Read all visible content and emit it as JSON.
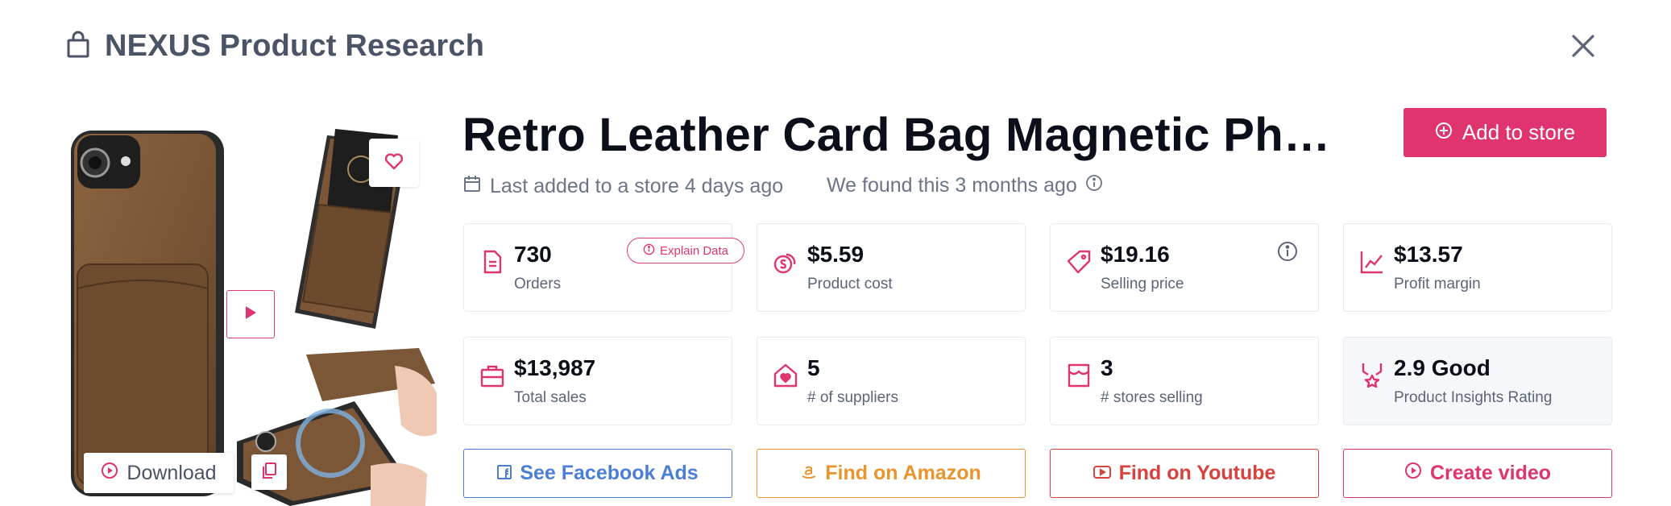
{
  "header": {
    "title": "NEXUS Product Research",
    "icon": "shopping-bag-icon"
  },
  "gallery": {
    "download_label": "Download"
  },
  "product": {
    "title": "Retro Leather Card Bag Magnetic Pho...",
    "add_label": "Add to store",
    "last_added": "Last added to a store 4 days ago",
    "found": "We found this 3 months ago"
  },
  "stats": [
    {
      "value": "730",
      "label": "Orders",
      "icon": "document-icon"
    },
    {
      "value": "$5.59",
      "label": "Product cost",
      "icon": "coins-icon"
    },
    {
      "value": "$19.16",
      "label": "Selling price",
      "icon": "tag-icon"
    },
    {
      "value": "$13.57",
      "label": "Profit margin",
      "icon": "chart-line-icon"
    },
    {
      "value": "$13,987",
      "label": "Total sales",
      "icon": "briefcase-icon"
    },
    {
      "value": "5",
      "label": "# of suppliers",
      "icon": "house-heart-icon"
    },
    {
      "value": "3",
      "label": "# stores selling",
      "icon": "store-icon"
    },
    {
      "value": "2.9 Good",
      "label": "Product Insights Rating",
      "icon": "award-icon"
    }
  ],
  "explain_label": "Explain Data",
  "actions": {
    "facebook": "See Facebook Ads",
    "amazon": "Find on Amazon",
    "youtube": "Find on Youtube",
    "video": "Create video"
  },
  "colors": {
    "accent": "#df3470",
    "facebook": "#4a7fd4",
    "amazon": "#e8952e",
    "youtube": "#d8413e",
    "header_text": "#4b5466"
  }
}
